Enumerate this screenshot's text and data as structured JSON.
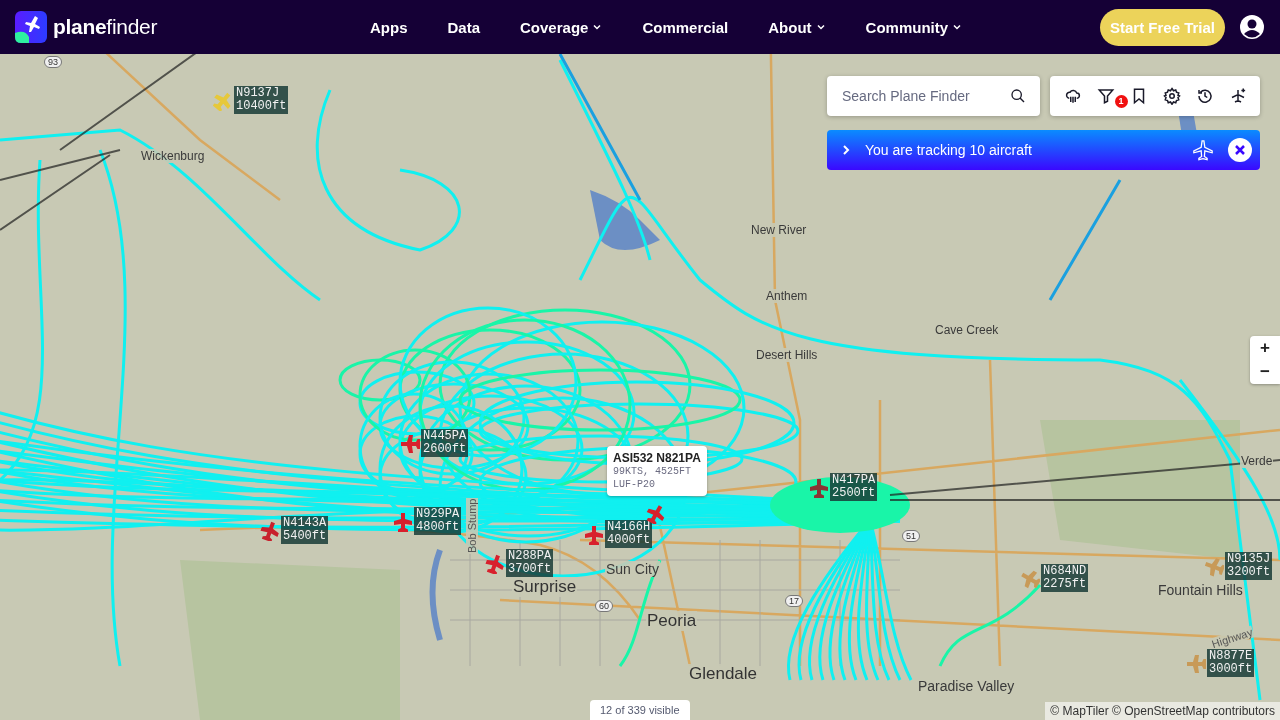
{
  "header": {
    "brand": "**plane**finder",
    "nav": [
      {
        "label": "Apps",
        "dropdown": false
      },
      {
        "label": "Data",
        "dropdown": false
      },
      {
        "label": "Coverage",
        "dropdown": true
      },
      {
        "label": "Commercial",
        "dropdown": false
      },
      {
        "label": "About",
        "dropdown": true
      },
      {
        "label": "Community",
        "dropdown": true
      }
    ],
    "cta": "Start Free Trial"
  },
  "search": {
    "placeholder": "Search Plane Finder"
  },
  "toolbar": {
    "filter_badge": "1"
  },
  "tracking_banner": {
    "text": "You are tracking 10 aircraft"
  },
  "places": [
    {
      "name": "Wickenburg",
      "kind": "town"
    },
    {
      "name": "New River",
      "kind": "town"
    },
    {
      "name": "Anthem",
      "kind": "town"
    },
    {
      "name": "Cave Creek",
      "kind": "town"
    },
    {
      "name": "Desert Hills",
      "kind": "town"
    },
    {
      "name": "Surprise",
      "kind": "city"
    },
    {
      "name": "Sun City",
      "kind": "suburb"
    },
    {
      "name": "Peoria",
      "kind": "city"
    },
    {
      "name": "Glendale",
      "kind": "city"
    },
    {
      "name": "Fountain Hills",
      "kind": "suburb"
    },
    {
      "name": "Paradise Valley",
      "kind": "suburb"
    },
    {
      "name": "Verde",
      "kind": "town"
    },
    {
      "name": "Bob Stump",
      "kind": "road"
    },
    {
      "name": "Highway",
      "kind": "road"
    }
  ],
  "route_shields": [
    "93",
    "51",
    "60",
    "17"
  ],
  "aircraft": [
    {
      "callsign": "N9137J",
      "altitude": "10400ft",
      "color": "#e6c83a"
    },
    {
      "callsign": "N445PA",
      "altitude": "2600ft",
      "color": "#d8202c"
    },
    {
      "callsign": "N4143A",
      "altitude": "5400ft",
      "color": "#c8202c"
    },
    {
      "callsign": "N929PA",
      "altitude": "4800ft",
      "color": "#d8202c"
    },
    {
      "callsign": "N288PA",
      "altitude": "3700ft",
      "color": "#d8202c"
    },
    {
      "callsign": "N4166H",
      "altitude": "4000ft",
      "color": "#d8202c"
    },
    {
      "callsign": "N417PA",
      "altitude": "2500ft",
      "color": "#8a3434"
    },
    {
      "callsign": "N684ND",
      "altitude": "2275ft",
      "color": "#c89a58"
    },
    {
      "callsign": "N9135J",
      "altitude": "3200ft",
      "color": "#c89a58"
    },
    {
      "callsign": "N8877E",
      "altitude": "3000ft",
      "color": "#c89a58"
    }
  ],
  "selected_aircraft": {
    "color": "#d8202c",
    "title": "ASI532 N821PA",
    "details": [
      "99KTS, 4525FT",
      "LUF-P20"
    ]
  },
  "visible_count": "12 of 339 visible",
  "zoom_controls": [
    "+",
    "−"
  ],
  "attribution": "© MapTiler © OpenStreetMap contributors"
}
